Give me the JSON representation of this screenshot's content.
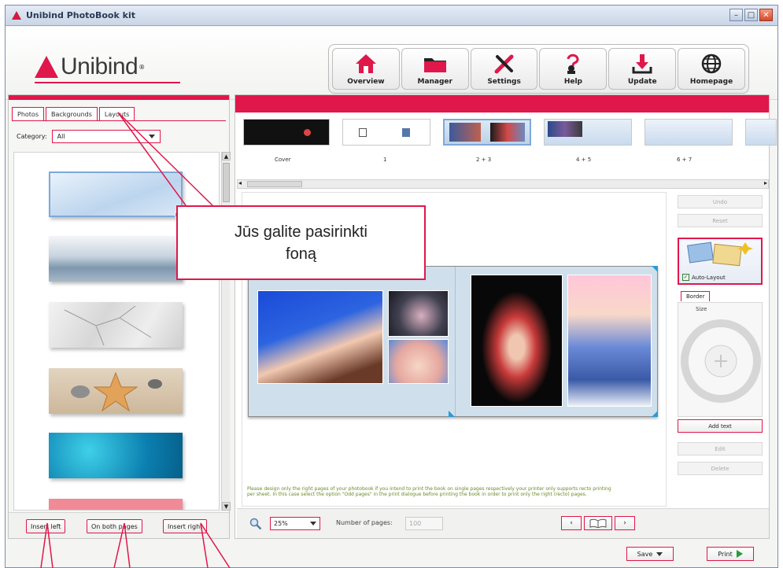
{
  "window": {
    "title": "Unibind PhotoBook kit",
    "min": "–",
    "max": "□",
    "close": "✕"
  },
  "brand": {
    "name": "Unibind",
    "reg": "®"
  },
  "nav": [
    {
      "label": "Overview",
      "icon": "home-icon"
    },
    {
      "label": "Manager",
      "icon": "folder-icon"
    },
    {
      "label": "Settings",
      "icon": "tools-icon"
    },
    {
      "label": "Help",
      "icon": "help-icon"
    },
    {
      "label": "Update",
      "icon": "download-icon"
    },
    {
      "label": "Homepage",
      "icon": "globe-icon"
    }
  ],
  "left": {
    "tabs": [
      "Photos",
      "Backgrounds",
      "Layouts"
    ],
    "active_tab": "Backgrounds",
    "category_label": "Category:",
    "category_value": "All",
    "buttons": {
      "insert_left": "Insert left",
      "both_pages": "On both pages",
      "insert_right": "Insert right"
    }
  },
  "pages": [
    "Cover",
    "1",
    "2 + 3",
    "4 + 5",
    "6 + 7"
  ],
  "side": {
    "undo": "Undo",
    "reset": "Reset",
    "autolayout": "Auto-Layout",
    "border_tab": "Border",
    "size_label": "Size",
    "add_text": "Add text",
    "edit": "Edit",
    "delete": "Delete"
  },
  "note": "Please design only the right pages of your photobook if you intend to print the book on single pages respectively your printer only supports recto printing per sheet. In this case select the option \"Odd pages\" in the print dialogue before printing the book in order to print only the right (recto) pages.",
  "bottom": {
    "zoom": "25%",
    "pages_label": "Number of pages:",
    "pages_value": "100"
  },
  "footer": {
    "save": "Save",
    "print": "Print"
  },
  "callout": {
    "line1": "Jūs galite pasirinkti",
    "line2": "foną"
  },
  "colors": {
    "accent": "#e0174a",
    "title_bg": "#c9d5e6"
  }
}
